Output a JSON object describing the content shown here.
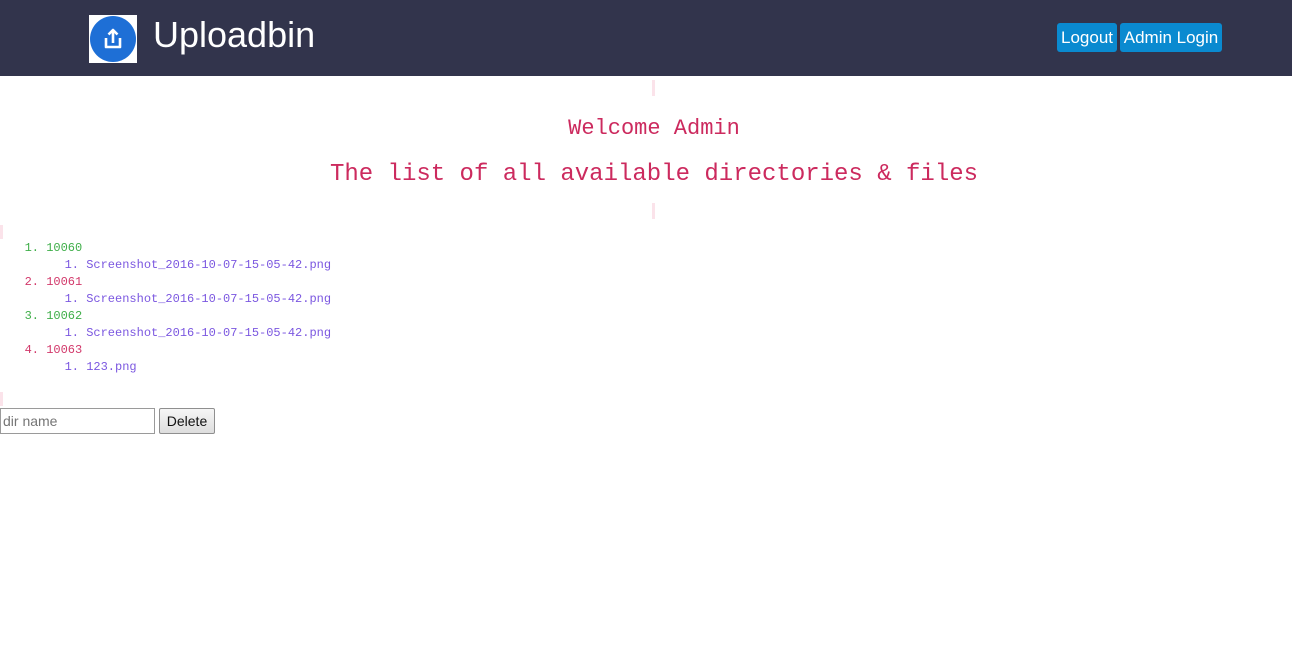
{
  "header": {
    "app_title": "Uploadbin",
    "logout_label": "Logout",
    "admin_login_label": "Admin Login",
    "logo_icon": "upload-icon",
    "background_color": "#32344c",
    "button_color": "#0a8ad0"
  },
  "main": {
    "welcome_text": "Welcome Admin",
    "list_heading": "The list of all available directories & files",
    "accent_color": "#cc2a5e"
  },
  "directories": [
    {
      "number": "1.",
      "name": "10060",
      "files": [
        {
          "number": "1.",
          "name": "Screenshot_2016-10-07-15-05-42.png"
        }
      ]
    },
    {
      "number": "2.",
      "name": "10061",
      "files": [
        {
          "number": "1.",
          "name": "Screenshot_2016-10-07-15-05-42.png"
        }
      ]
    },
    {
      "number": "3.",
      "name": "10062",
      "files": [
        {
          "number": "1.",
          "name": "Screenshot_2016-10-07-15-05-42.png"
        }
      ]
    },
    {
      "number": "4.",
      "name": "10063",
      "files": [
        {
          "number": "1.",
          "name": "123.png"
        }
      ]
    }
  ],
  "delete_form": {
    "input_placeholder": "dir name",
    "input_value": "",
    "delete_label": "Delete"
  }
}
